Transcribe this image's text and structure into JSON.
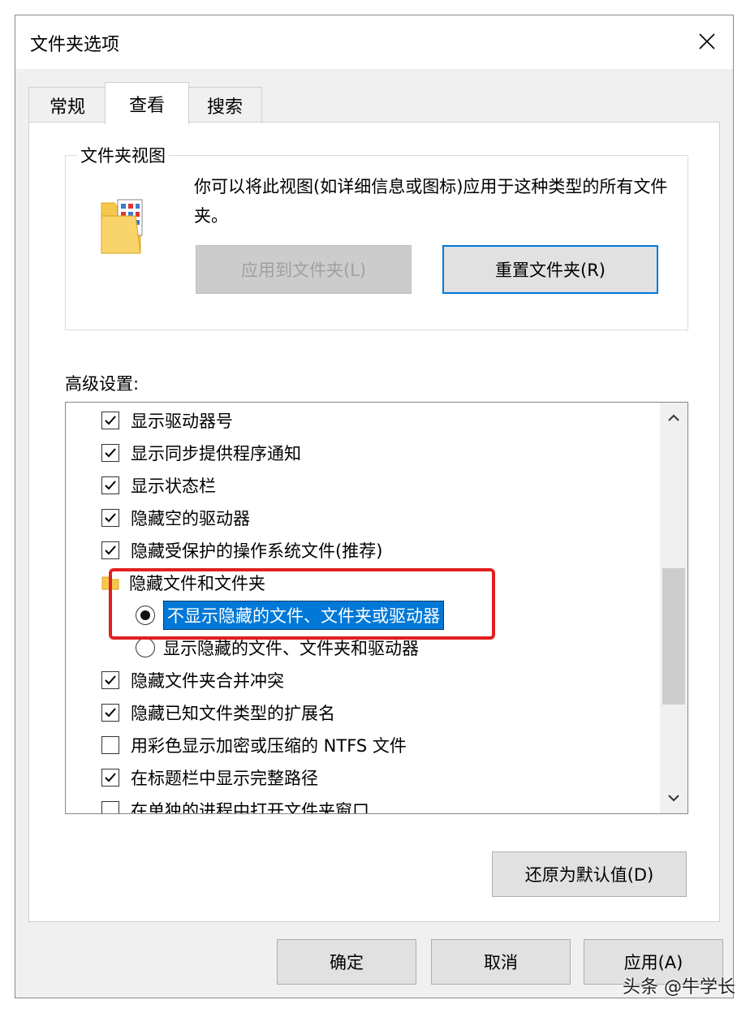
{
  "window": {
    "title": "文件夹选项",
    "close_icon": "close-icon"
  },
  "tabs": [
    {
      "label": "常规",
      "active": false
    },
    {
      "label": "查看",
      "active": true
    },
    {
      "label": "搜索",
      "active": false
    }
  ],
  "folder_views": {
    "title": "文件夹视图",
    "description": "你可以将此视图(如详细信息或图标)应用于这种类型的所有文件夹。",
    "apply_button": "应用到文件夹(L)",
    "reset_button": "重置文件夹(R)"
  },
  "advanced": {
    "label": "高级设置:",
    "items": [
      {
        "type": "checkbox",
        "checked": true,
        "label": "显示驱动器号"
      },
      {
        "type": "checkbox",
        "checked": true,
        "label": "显示同步提供程序通知"
      },
      {
        "type": "checkbox",
        "checked": true,
        "label": "显示状态栏"
      },
      {
        "type": "checkbox",
        "checked": true,
        "label": "隐藏空的驱动器"
      },
      {
        "type": "checkbox",
        "checked": true,
        "label": "隐藏受保护的操作系统文件(推荐)"
      },
      {
        "type": "folder",
        "label": "隐藏文件和文件夹"
      },
      {
        "type": "radio",
        "checked": true,
        "selected": true,
        "label": "不显示隐藏的文件、文件夹或驱动器"
      },
      {
        "type": "radio",
        "checked": false,
        "label": "显示隐藏的文件、文件夹和驱动器"
      },
      {
        "type": "checkbox",
        "checked": true,
        "label": "隐藏文件夹合并冲突"
      },
      {
        "type": "checkbox",
        "checked": true,
        "label": "隐藏已知文件类型的扩展名"
      },
      {
        "type": "checkbox",
        "checked": false,
        "label": "用彩色显示加密或压缩的 NTFS 文件"
      },
      {
        "type": "checkbox",
        "checked": true,
        "label": "在标题栏中显示完整路径"
      },
      {
        "type": "checkbox",
        "checked": false,
        "label": "在单独的进程中打开文件夹窗口"
      }
    ]
  },
  "restore_defaults_button": "还原为默认值(D)",
  "footer": {
    "ok": "确定",
    "cancel": "取消",
    "apply": "应用(A)"
  },
  "watermark": "头条 @牛学长",
  "colors": {
    "highlight": "#0078d7",
    "annotation": "#e02020"
  }
}
